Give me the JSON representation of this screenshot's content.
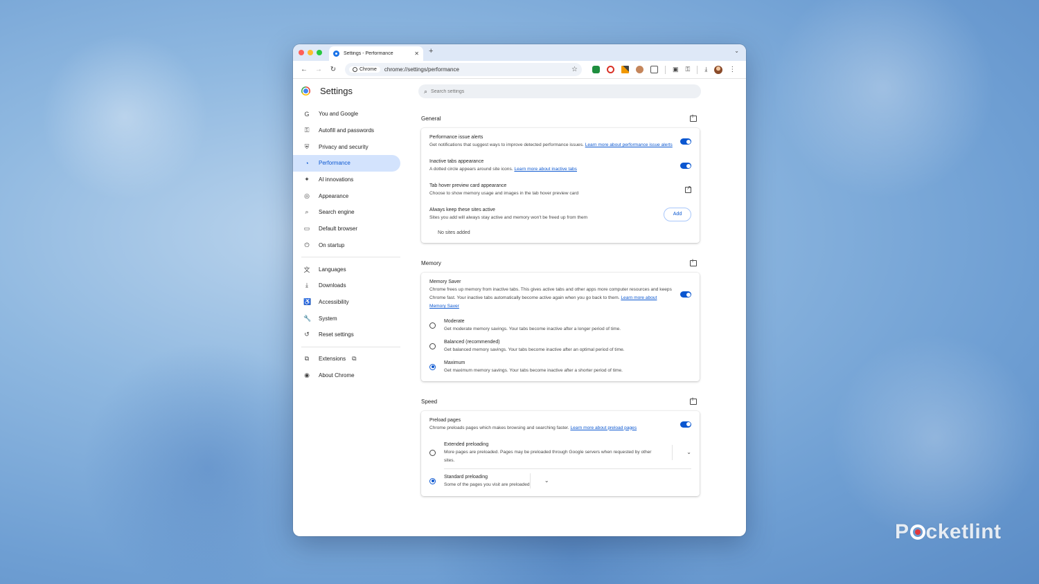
{
  "tab": {
    "title": "Settings - Performance",
    "close": "✕",
    "new": "+"
  },
  "toolbar": {
    "chip_label": "Chrome",
    "url": "chrome://settings/performance"
  },
  "settings": {
    "title": "Settings",
    "search_placeholder": "Search settings"
  },
  "sidebar": {
    "group1": [
      {
        "label": "You and Google",
        "icon": "G"
      },
      {
        "label": "Autofill and passwords",
        "icon": "⚿"
      },
      {
        "label": "Privacy and security",
        "icon": "⛨"
      },
      {
        "label": "Performance",
        "icon": "◔"
      },
      {
        "label": "AI innovations",
        "icon": "✦"
      },
      {
        "label": "Appearance",
        "icon": "◎"
      },
      {
        "label": "Search engine",
        "icon": "⌕"
      },
      {
        "label": "Default browser",
        "icon": "▭"
      },
      {
        "label": "On startup",
        "icon": "⏻"
      }
    ],
    "group2": [
      {
        "label": "Languages",
        "icon": "文"
      },
      {
        "label": "Downloads",
        "icon": "⤓"
      },
      {
        "label": "Accessibility",
        "icon": "♿"
      },
      {
        "label": "System",
        "icon": "🔧"
      },
      {
        "label": "Reset settings",
        "icon": "↺"
      }
    ],
    "group3": [
      {
        "label": "Extensions",
        "icon": "⧉"
      },
      {
        "label": "About Chrome",
        "icon": "◉"
      }
    ]
  },
  "general": {
    "title": "General",
    "alerts_title": "Performance issue alerts",
    "alerts_sub": "Get notifications that suggest ways to improve detected performance issues.",
    "alerts_link": "Learn more about performance issue alerts",
    "inactive_title": "Inactive tabs appearance",
    "inactive_sub": "A dotted circle appears around site icons.",
    "inactive_link": "Learn more about inactive tabs",
    "hover_title": "Tab hover preview card appearance",
    "hover_sub": "Choose to show memory usage and images in the tab hover preview card",
    "keep_title": "Always keep these sites active",
    "keep_sub": "Sites you add will always stay active and memory won't be freed up from them",
    "add_label": "Add",
    "empty": "No sites added"
  },
  "memory": {
    "title": "Memory",
    "saver_title": "Memory Saver",
    "saver_sub": "Chrome frees up memory from inactive tabs. This gives active tabs and other apps more computer resources and keeps Chrome fast. Your inactive tabs automatically become active again when you go back to them.",
    "saver_link": "Learn more about Memory Saver",
    "options": [
      {
        "title": "Moderate",
        "sub": "Get moderate memory savings. Your tabs become inactive after a longer period of time.",
        "checked": false
      },
      {
        "title": "Balanced (recommended)",
        "sub": "Get balanced memory savings. Your tabs become inactive after an optimal period of time.",
        "checked": false
      },
      {
        "title": "Maximum",
        "sub": "Get maximum memory savings. Your tabs become inactive after a shorter period of time.",
        "checked": true
      }
    ]
  },
  "speed": {
    "title": "Speed",
    "preload_title": "Preload pages",
    "preload_sub": "Chrome preloads pages which makes browsing and searching faster.",
    "preload_link": "Learn more about preload pages",
    "options": [
      {
        "title": "Extended preloading",
        "sub": "More pages are preloaded. Pages may be preloaded through Google servers when requested by other sites.",
        "checked": false
      },
      {
        "title": "Standard preloading",
        "sub": "Some of the pages you visit are preloaded",
        "checked": true
      }
    ]
  },
  "watermark": {
    "pre": "P",
    "post": "cketlint"
  },
  "colors": {
    "accent": "#0b57d0",
    "active_nav_bg": "#d3e3fd"
  }
}
